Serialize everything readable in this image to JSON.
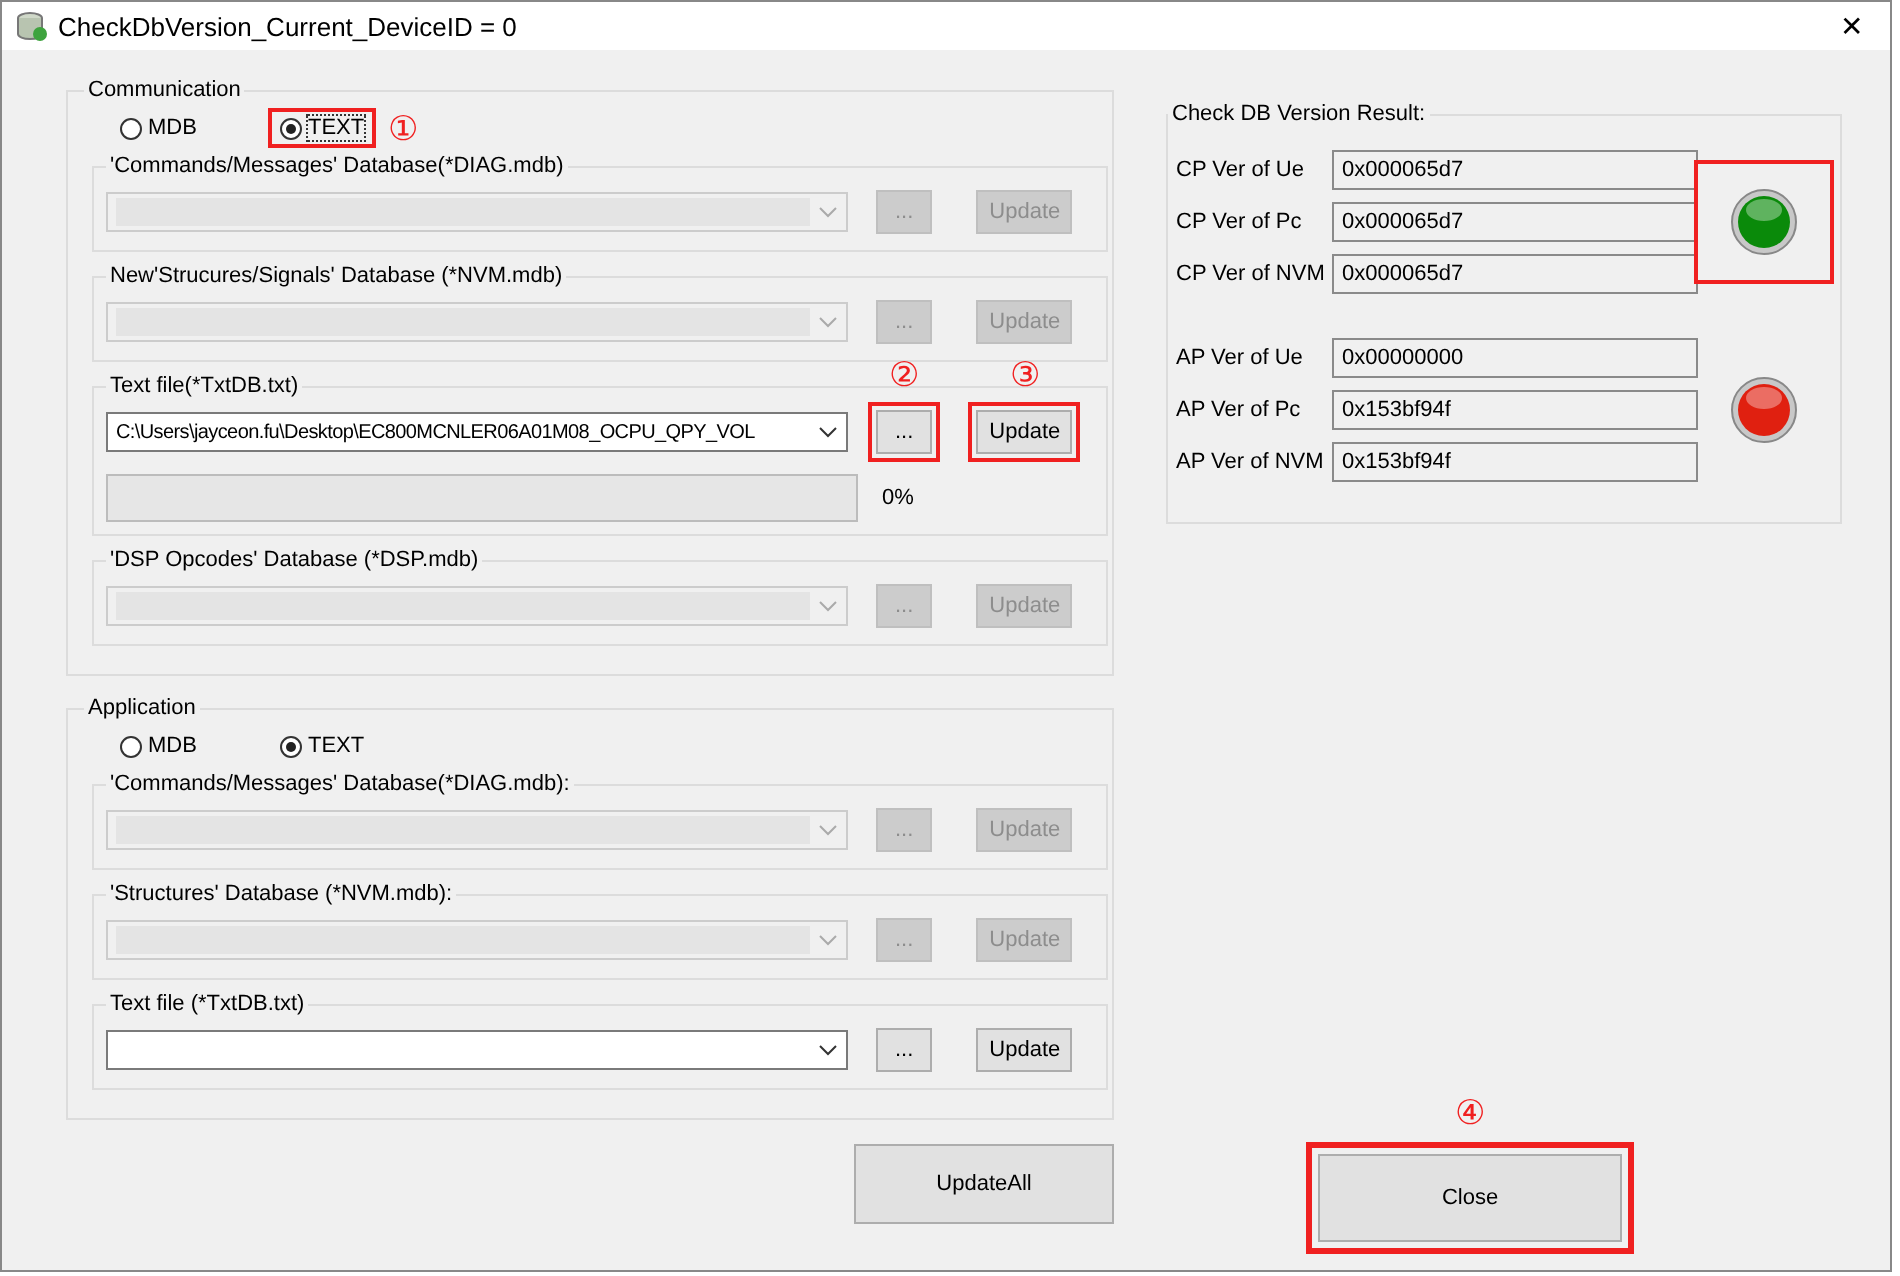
{
  "window": {
    "title": "CheckDbVersion_Current_DeviceID = 0",
    "close": "✕"
  },
  "groups": [
    {
      "legend": "Communication",
      "radios": [
        {
          "label": "MDB",
          "selected": false,
          "highlighted": false
        },
        {
          "label": "TEXT",
          "selected": true,
          "highlighted": true,
          "annotation": "①"
        }
      ],
      "sections": [
        {
          "title": "'Commands/Messages' Database(*DIAG.mdb)",
          "enabled": false,
          "browse": {
            "label": "...",
            "highlighted": false
          },
          "update": {
            "label": "Update",
            "highlighted": false
          }
        },
        {
          "title": "New'Strucures/Signals' Database (*NVM.mdb)",
          "enabled": false,
          "browse": {
            "label": "...",
            "highlighted": false
          },
          "update": {
            "label": "Update",
            "highlighted": false
          }
        },
        {
          "title": "Text file(*TxtDB.txt)",
          "enabled": true,
          "value": "C:\\Users\\jayceon.fu\\Desktop\\EC800MCNLER06A01M08_OCPU_QPY_VOL",
          "browse": {
            "label": "...",
            "highlighted": true,
            "annotation": "②"
          },
          "update": {
            "label": "Update",
            "highlighted": true,
            "annotation": "③"
          },
          "progress": {
            "level": 0,
            "reading": "0%"
          }
        },
        {
          "title": "'DSP Opcodes' Database (*DSP.mdb)",
          "enabled": false,
          "browse": {
            "label": "...",
            "highlighted": false
          },
          "update": {
            "label": "Update",
            "highlighted": false
          }
        }
      ]
    },
    {
      "legend": "Application",
      "radios": [
        {
          "label": "MDB",
          "selected": false,
          "highlighted": false
        },
        {
          "label": "TEXT",
          "selected": true,
          "highlighted": false
        }
      ],
      "sections": [
        {
          "title": "'Commands/Messages' Database(*DIAG.mdb):",
          "enabled": false,
          "browse": {
            "label": "...",
            "highlighted": false
          },
          "update": {
            "label": "Update",
            "highlighted": false
          }
        },
        {
          "title": "'Structures' Database (*NVM.mdb):",
          "enabled": false,
          "browse": {
            "label": "...",
            "highlighted": false
          },
          "update": {
            "label": "Update",
            "highlighted": false
          }
        },
        {
          "title": "Text file (*TxtDB.txt)",
          "enabled": true,
          "browse": {
            "label": "...",
            "highlighted": false
          },
          "update": {
            "label": "Update",
            "highlighted": false
          }
        }
      ]
    }
  ],
  "update_all": {
    "label": "UpdateAll"
  },
  "result": {
    "legend": "Check DB Version Result:",
    "blocks": [
      {
        "rows": [
          {
            "label": "CP Ver of Ue",
            "value": "0x000065d7"
          },
          {
            "label": "CP Ver of Pc",
            "value": "0x000065d7"
          },
          {
            "label": "CP Ver of NVM",
            "value": "0x000065d7"
          }
        ],
        "color": "#0a8a0a",
        "highlighted": true
      },
      {
        "rows": [
          {
            "label": "AP Ver of Ue",
            "value": "0x00000000"
          },
          {
            "label": "AP Ver of Pc",
            "value": "0x153bf94f"
          },
          {
            "label": "AP Ver of NVM",
            "value": "0x153bf94f"
          }
        ],
        "color": "#e02010",
        "highlighted": false
      }
    ]
  },
  "close_button": {
    "label": "Close",
    "highlighted": true,
    "annotation": "④"
  }
}
